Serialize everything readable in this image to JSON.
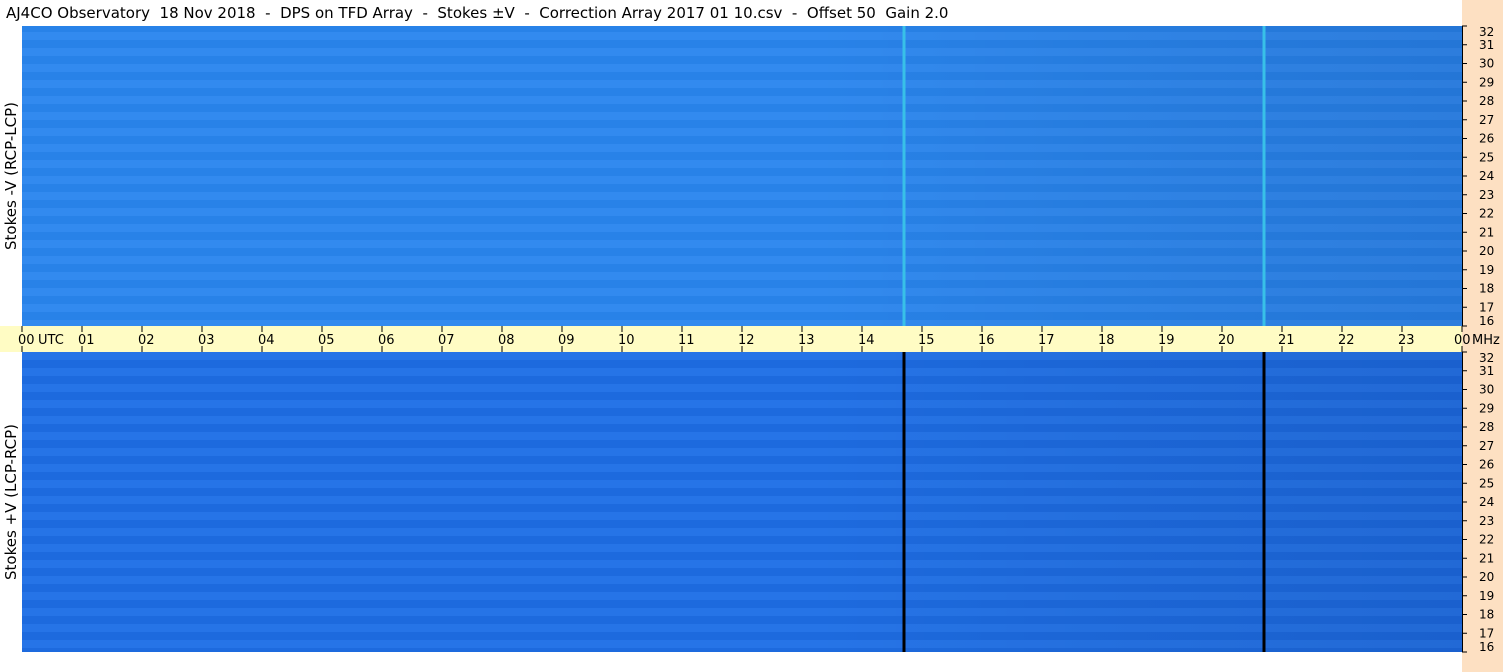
{
  "title": "AJ4CO Observatory  18 Nov 2018  -  DPS on TFD Array  -  Stokes ±V  -  Correction Array 2017 01 10.csv  -  Offset 50  Gain 2.0",
  "chart_data": {
    "type": "heatmap",
    "panels": [
      {
        "name": "Stokes -V (RCP-LCP)",
        "ylabel": "Stokes -V (RCP-LCP)",
        "base_color": "#2a86ee",
        "marker_color": "#38c0e8",
        "ylim": [
          16,
          32
        ],
        "yticks": [
          16,
          17,
          18,
          19,
          20,
          21,
          22,
          23,
          24,
          25,
          26,
          27,
          28,
          29,
          30,
          31,
          32
        ],
        "unit": ""
      },
      {
        "name": "Stokes +V (LCP-RCP)",
        "ylabel": "Stokes +V (LCP-RCP)",
        "base_color": "#1f6fe6",
        "marker_color": "#000000",
        "ylim": [
          16,
          32
        ],
        "yticks": [
          16,
          17,
          18,
          19,
          20,
          21,
          22,
          23,
          24,
          25,
          26,
          27,
          28,
          29,
          30,
          31,
          32
        ],
        "unit": "MHz"
      }
    ],
    "x_axis": {
      "labels": [
        "00",
        "01",
        "02",
        "03",
        "04",
        "05",
        "06",
        "07",
        "08",
        "09",
        "10",
        "11",
        "12",
        "13",
        "14",
        "15",
        "16",
        "17",
        "18",
        "19",
        "20",
        "21",
        "22",
        "23",
        "00"
      ],
      "first_suffix": "UTC",
      "xlim_hours": [
        0,
        24
      ]
    },
    "vertical_markers_hours": [
      14.7,
      20.7
    ]
  }
}
